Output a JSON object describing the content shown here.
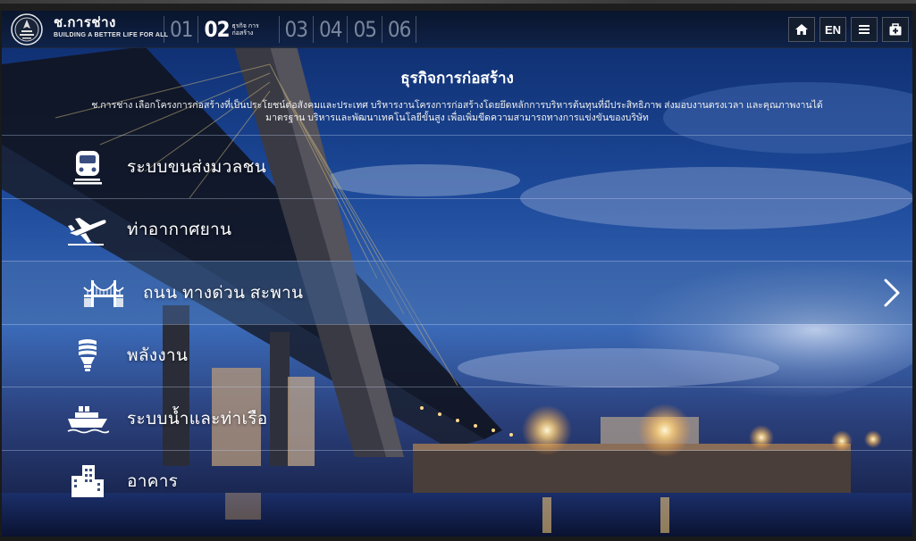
{
  "brand": {
    "name": "ช.การช่าง",
    "tagline": "BUILDING A BETTER LIFE FOR ALL"
  },
  "steps": [
    {
      "number": "01"
    },
    {
      "number": "02",
      "caption": "ธุรกิจ การก่อสร้าง"
    },
    {
      "number": "03"
    },
    {
      "number": "04"
    },
    {
      "number": "05"
    },
    {
      "number": "06"
    }
  ],
  "nav": {
    "home_icon": "home-icon",
    "language": "EN",
    "menu_icon": "hamburger-menu-icon",
    "extra_icon": "medical-kit-icon"
  },
  "section": {
    "title": "ธุรกิจการก่อสร้าง",
    "description": "ช.การช่าง เลือกโครงการก่อสร้างที่เป็นประโยชน์ต่อสังคมและประเทศ บริหารงานโครงการก่อสร้างโดยยึดหลักการบริหารต้นทุนที่มีประสิทธิภาพ ส่งมอบงานตรงเวลา และคุณภาพงานได้มาตรฐาน บริหารและพัฒนาเทคโนโลยีขั้นสูง เพื่อเพิ่มขีดความสามารถทางการแข่งขันของบริษัท"
  },
  "menu": [
    {
      "label": "ระบบขนส่งมวลชน",
      "icon": "train-icon"
    },
    {
      "label": "ท่าอากาศยาน",
      "icon": "airplane-icon"
    },
    {
      "label": "ถนน ทางด่วน สะพาน",
      "icon": "bridge-icon",
      "selected": true
    },
    {
      "label": "พลังงาน",
      "icon": "lightbulb-icon"
    },
    {
      "label": "ระบบน้ำและท่าเรือ",
      "icon": "ship-icon"
    },
    {
      "label": "อาคาร",
      "icon": "building-icon"
    }
  ],
  "colors": {
    "topbar": "#0f1e3c",
    "selected_row": "#466eaa",
    "text": "#ffffff"
  }
}
